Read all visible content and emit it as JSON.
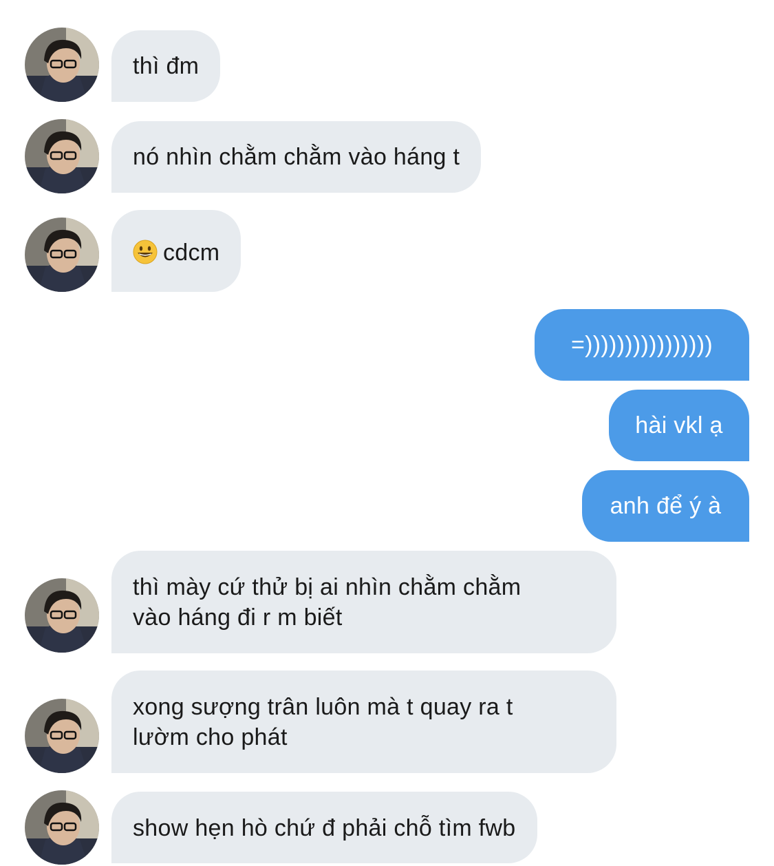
{
  "conversation": {
    "messages": [
      {
        "side": "in",
        "lines": [
          "thì đm"
        ]
      },
      {
        "side": "in",
        "lines": [
          "nó nhìn chằm chằm vào háng t"
        ]
      },
      {
        "side": "in",
        "emoji": "grinning-face-icon",
        "lines": [
          "cdcm"
        ]
      },
      {
        "side": "out",
        "lines": [
          "=))))))))))))))))"
        ]
      },
      {
        "side": "out",
        "lines": [
          "hài vkl ạ"
        ]
      },
      {
        "side": "out",
        "lines": [
          "anh để ý à"
        ]
      },
      {
        "side": "in",
        "lines": [
          "thì mày cứ thử bị ai nhìn chằm chằm",
          "vào háng đi r m biết"
        ]
      },
      {
        "side": "in",
        "lines": [
          "xong sượng trân luôn mà t quay ra t",
          "lườm cho phát"
        ]
      },
      {
        "side": "in",
        "lines": [
          "show hẹn hò chứ đ phải chỗ tìm fwb"
        ]
      }
    ]
  },
  "colors": {
    "incoming_bubble": "#e7ebef",
    "outgoing_bubble": "#4c9be8",
    "incoming_text": "#1a1a1a",
    "outgoing_text": "#ffffff"
  }
}
